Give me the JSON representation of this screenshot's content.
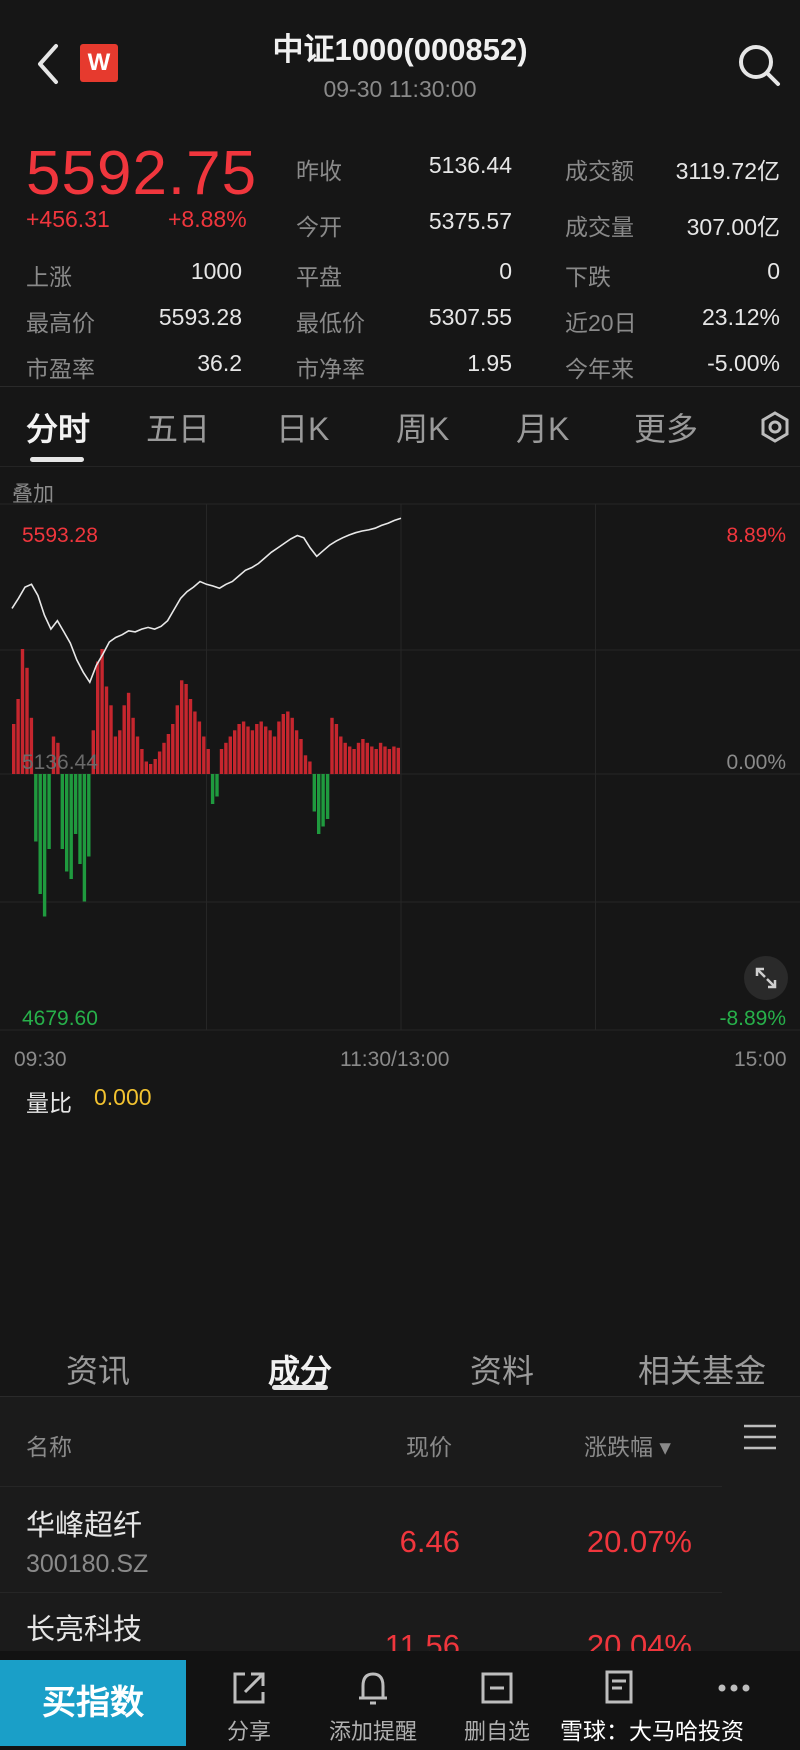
{
  "header": {
    "title": "中证1000(000852)",
    "subtitle": "09-30 11:30:00",
    "logo_letter": "W"
  },
  "quote": {
    "price": "5592.75",
    "change": "+456.31",
    "change_pct": "+8.88%",
    "stats": [
      {
        "label": "昨收",
        "value": "5136.44"
      },
      {
        "label": "成交额",
        "value": "3119.72亿"
      },
      {
        "label": "今开",
        "value": "5375.57"
      },
      {
        "label": "成交量",
        "value": "307.00亿"
      },
      {
        "label": "上涨",
        "value": "1000"
      },
      {
        "label": "平盘",
        "value": "0"
      },
      {
        "label": "下跌",
        "value": "0"
      },
      {
        "label": "最高价",
        "value": "5593.28"
      },
      {
        "label": "最低价",
        "value": "5307.55"
      },
      {
        "label": "近20日",
        "value": "23.12%"
      },
      {
        "label": "市盈率",
        "value": "36.2"
      },
      {
        "label": "市净率",
        "value": "1.95"
      },
      {
        "label": "今年来",
        "value": "-5.00%"
      }
    ]
  },
  "chart_tabs": [
    "分时",
    "五日",
    "日K",
    "周K",
    "月K",
    "更多"
  ],
  "chart_overlay_label": "叠加",
  "volume_ratio": {
    "label": "量比",
    "value": "0.000"
  },
  "chart_data": {
    "type": "line",
    "y_labels": {
      "top": "5593.28",
      "mid": "5136.44",
      "bottom": "4679.60"
    },
    "pct_labels": {
      "top": "8.89%",
      "mid": "0.00%",
      "bottom": "-8.89%"
    },
    "x_ticks": [
      "09:30",
      "11:30/13:00",
      "15:00"
    ],
    "ylim": [
      4679.6,
      5593.28
    ],
    "prev_close": 5136.44,
    "price_series": {
      "x_minutes": [
        0,
        2,
        4,
        6,
        8,
        10,
        12,
        14,
        16,
        18,
        20,
        22,
        24,
        26,
        28,
        30,
        32,
        34,
        36,
        38,
        40,
        42,
        44,
        46,
        48,
        50,
        52,
        54,
        56,
        58,
        60,
        62,
        64,
        66,
        68,
        70,
        72,
        74,
        76,
        78,
        80,
        82,
        84,
        86,
        88,
        90,
        92,
        94,
        96,
        98,
        100,
        102,
        104,
        106,
        108,
        110,
        112,
        114,
        116,
        118,
        120
      ],
      "values": [
        5432,
        5450,
        5470,
        5475,
        5455,
        5420,
        5395,
        5410,
        5390,
        5370,
        5340,
        5318,
        5300,
        5330,
        5350,
        5372,
        5380,
        5385,
        5392,
        5390,
        5395,
        5398,
        5395,
        5400,
        5410,
        5430,
        5450,
        5462,
        5470,
        5480,
        5475,
        5472,
        5468,
        5475,
        5480,
        5490,
        5500,
        5505,
        5512,
        5522,
        5532,
        5540,
        5548,
        5556,
        5562,
        5558,
        5540,
        5525,
        5535,
        5545,
        5552,
        5558,
        5563,
        5567,
        5570,
        5572,
        5575,
        5580,
        5584,
        5589,
        5592.75
      ]
    },
    "flow_bars": [
      0.4,
      0.6,
      1.0,
      0.85,
      0.45,
      -0.45,
      -0.8,
      -0.95,
      -0.5,
      0.3,
      0.25,
      -0.5,
      -0.65,
      -0.7,
      -0.4,
      -0.6,
      -0.85,
      -0.55,
      0.35,
      0.9,
      1.0,
      0.7,
      0.55,
      0.3,
      0.35,
      0.55,
      0.65,
      0.45,
      0.3,
      0.2,
      0.1,
      0.08,
      0.12,
      0.18,
      0.25,
      0.32,
      0.4,
      0.55,
      0.75,
      0.72,
      0.6,
      0.5,
      0.42,
      0.3,
      0.2,
      -0.2,
      -0.15,
      0.2,
      0.25,
      0.3,
      0.35,
      0.4,
      0.42,
      0.38,
      0.35,
      0.4,
      0.42,
      0.38,
      0.35,
      0.3,
      0.42,
      0.48,
      0.5,
      0.45,
      0.35,
      0.28,
      0.15,
      0.1,
      -0.25,
      -0.4,
      -0.35,
      -0.3,
      0.45,
      0.4,
      0.3,
      0.25,
      0.22,
      0.2,
      0.25,
      0.28,
      0.25,
      0.22,
      0.2,
      0.25,
      0.22,
      0.2,
      0.22,
      0.21
    ]
  },
  "bottom_tabs": [
    "资讯",
    "成分",
    "资料",
    "相关基金"
  ],
  "list": {
    "headers": {
      "name": "名称",
      "price": "现价",
      "change": "涨跌幅 ▾"
    },
    "rows": [
      {
        "name": "华峰超纤",
        "code": "300180.SZ",
        "price": "6.46",
        "change": "20.07%"
      },
      {
        "name": "长亮科技",
        "code": "",
        "price": "11.56",
        "change": "20.04%"
      }
    ]
  },
  "bottom_nav": {
    "buy_label": "买指数",
    "items": [
      {
        "label": "分享",
        "icon": "share-icon"
      },
      {
        "label": "添加提醒",
        "icon": "bell-icon"
      },
      {
        "label": "删自选",
        "icon": "remove-watchlist-icon"
      },
      {
        "label": "",
        "icon": "edit-note-icon"
      },
      {
        "label": "",
        "icon": "more-icon"
      }
    ]
  },
  "watermark": "雪球：大马哈投资",
  "colors": {
    "up": "#f0363d",
    "down": "#27b04a",
    "accent": "#1a9fc8",
    "ratio": "#f2c230"
  }
}
